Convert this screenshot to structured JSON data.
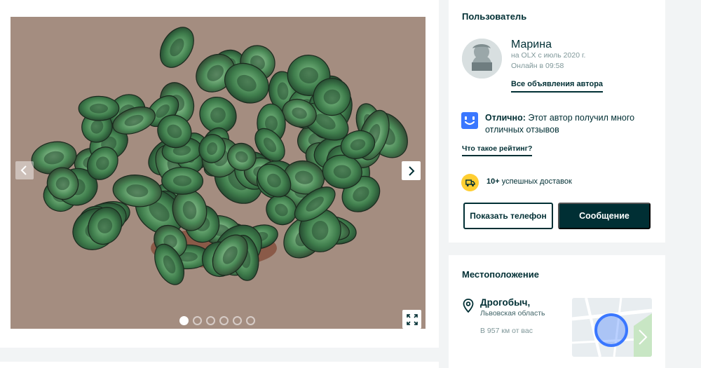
{
  "gallery": {
    "photo_alt": "",
    "dots_count": 6,
    "active_dot": 0,
    "icons": {
      "prev": "chevron-left-icon",
      "next": "chevron-right-icon",
      "fullscreen": "expand-icon"
    }
  },
  "user": {
    "section_title": "Пользователь",
    "name": "Марина",
    "since": "на OLX с июль 2020 г.",
    "online": "Онлайн в 09:58",
    "all_ads_link": "Все объявления автора",
    "rating_strong": "Отлично:",
    "rating_text": " Этот автор получил много отличных отзывов",
    "rating_link": "Что такое рейтинг?",
    "deliveries_strong": "10+",
    "deliveries_text": " успешных доставок",
    "phone_button": "Показать телефон",
    "message_button": "Сообщение",
    "colors": {
      "brand_dark": "#002f34",
      "rating_blue": "#3a77ff",
      "delivery_yellow": "#ffce32"
    }
  },
  "location": {
    "section_title": "Местоположение",
    "city": "Дрогобыч,",
    "region": "Львовская область",
    "distance": "В 957 км от вас",
    "icons": {
      "pin": "location-pin-icon"
    }
  }
}
